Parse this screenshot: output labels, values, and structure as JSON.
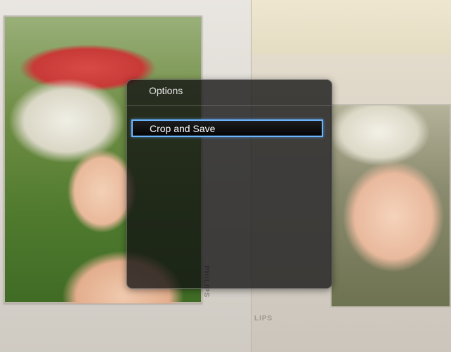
{
  "brand": {
    "logo_text": "PHILIPS",
    "logo_text_partial": "LIPS"
  },
  "options_dialog": {
    "title": "Options",
    "items": [
      {
        "label": "Crop and Save",
        "selected": true
      }
    ]
  },
  "colors": {
    "selection_border": "#6bb5ff",
    "dialog_background": "#121212"
  }
}
